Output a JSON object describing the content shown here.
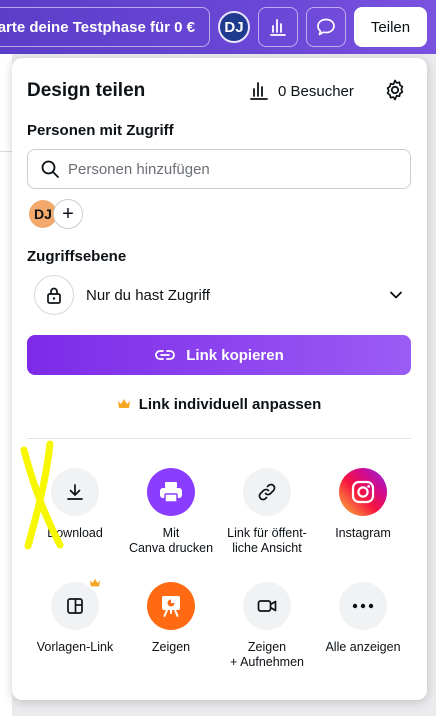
{
  "topbar": {
    "trial_label": "tarte deine Testphase für 0 €",
    "avatar_initials": "DJ",
    "share_label": "Teilen"
  },
  "panel": {
    "title": "Design teilen",
    "visitors_label": "0 Besucher",
    "people_label": "Personen mit Zugriff",
    "search_placeholder": "Personen hinzufügen",
    "member_initials": "DJ",
    "access_label": "Zugriffsebene",
    "access_value": "Nur du hast Zugriff",
    "copy_link_label": "Link kopieren",
    "custom_link_label": "Link individuell anpassen",
    "actions": [
      {
        "line1": "Download",
        "line2": ""
      },
      {
        "line1": "Mit",
        "line2": "Canva drucken"
      },
      {
        "line1": "Link für öffent-",
        "line2": "liche Ansicht"
      },
      {
        "line1": "Instagram",
        "line2": ""
      },
      {
        "line1": "Vorlagen-Link",
        "line2": ""
      },
      {
        "line1": "Zeigen",
        "line2": ""
      },
      {
        "line1": "Zeigen",
        "line2": "+ Aufnehmen"
      },
      {
        "line1": "Alle anzeigen",
        "line2": ""
      }
    ]
  },
  "colors": {
    "brand_purple": "#7d2ae8",
    "crown_gold": "#f5a623",
    "print_purple": "#8b3dff",
    "present_orange": "#ff6a13"
  }
}
